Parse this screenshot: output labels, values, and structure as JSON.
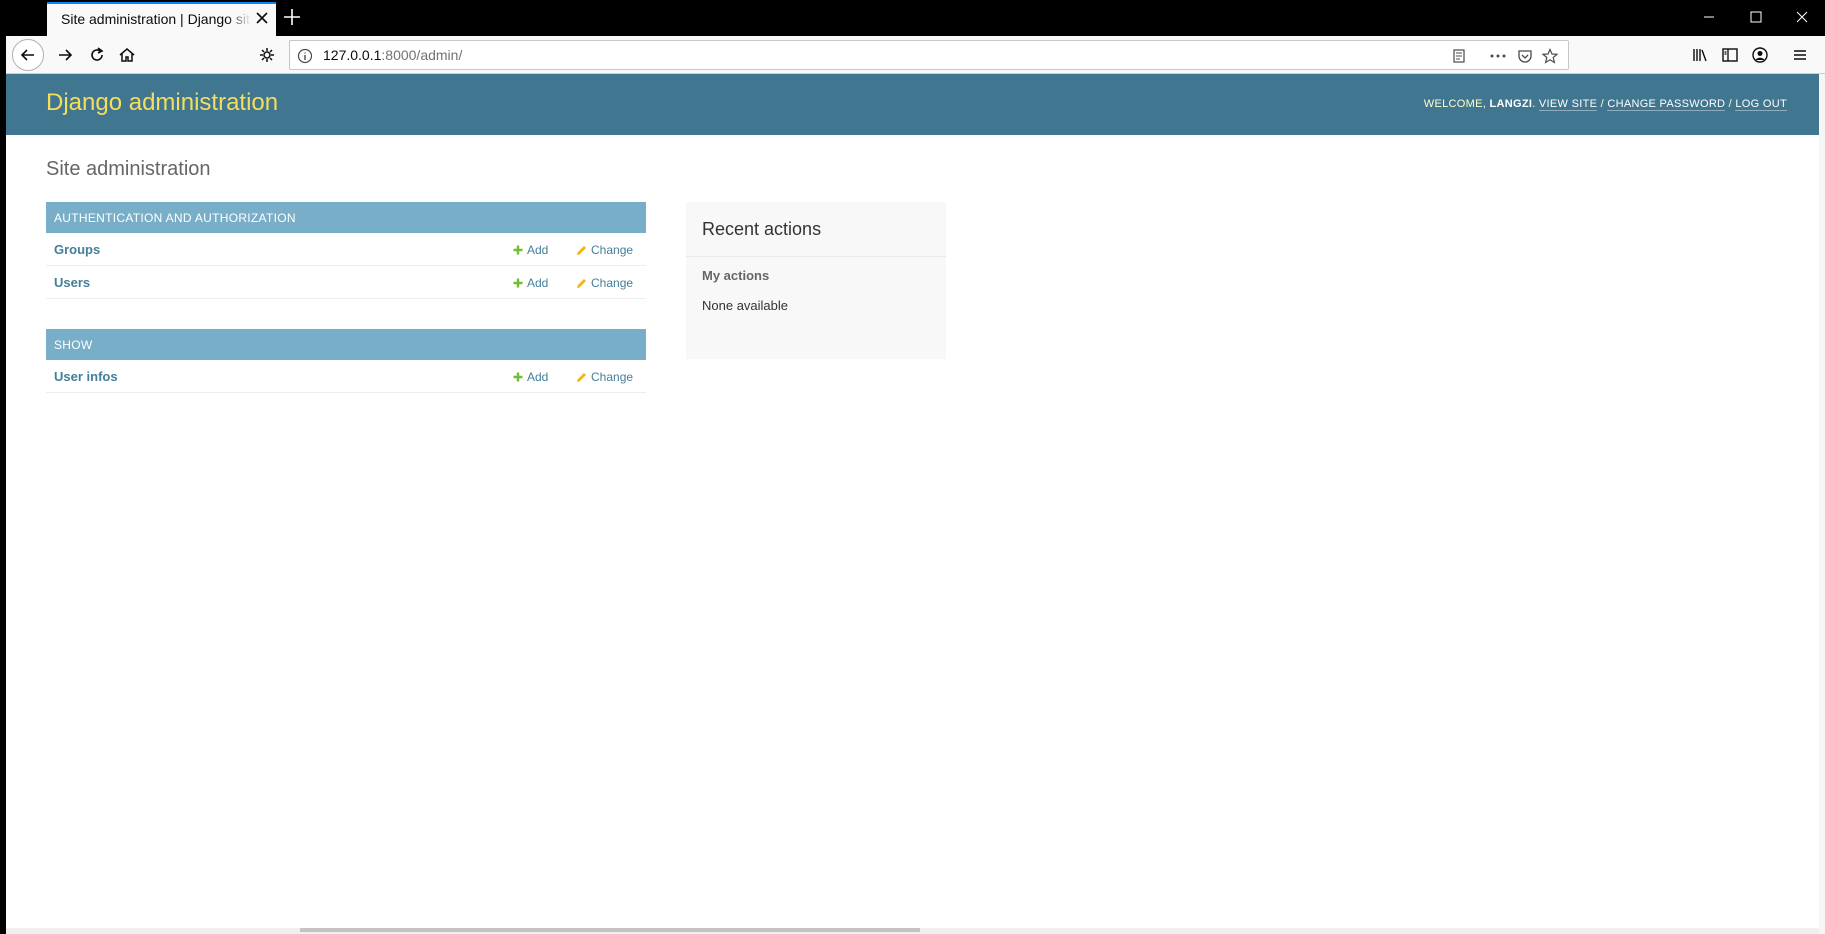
{
  "browser": {
    "tab_title": "Site administration | Django site admin",
    "url_host": "127.0.0.1",
    "url_rest": ":8000/admin/"
  },
  "header": {
    "brand": "Django administration",
    "welcome": "Welcome,",
    "username": "LANGZI",
    "view_site": "View site",
    "change_password": "Change password",
    "log_out": "Log out",
    "sep": "/"
  },
  "content": {
    "title": "Site administration"
  },
  "modules": [
    {
      "caption": "Authentication and Authorization",
      "models": [
        {
          "name": "Groups",
          "add": "Add",
          "change": "Change"
        },
        {
          "name": "Users",
          "add": "Add",
          "change": "Change"
        }
      ]
    },
    {
      "caption": "Show",
      "models": [
        {
          "name": "User infos",
          "add": "Add",
          "change": "Change"
        }
      ]
    }
  ],
  "recent": {
    "title": "Recent actions",
    "subtitle": "My actions",
    "empty": "None available"
  },
  "colors": {
    "header_bg": "#417690",
    "brand": "#f5dd5d",
    "caption_bg": "#79aec8",
    "link": "#447e9b",
    "add_icon": "#70bf2b",
    "change_icon": "#efb80b"
  },
  "icons": [
    "close-icon",
    "plus-icon",
    "minimize-icon",
    "maximize-icon",
    "back-icon",
    "forward-icon",
    "reload-icon",
    "home-icon",
    "gear-icon",
    "info-icon",
    "reader-icon",
    "more-icon",
    "pocket-icon",
    "star-icon",
    "library-icon",
    "sidebar-icon",
    "account-icon",
    "menu-icon",
    "add-icon",
    "pencil-icon"
  ]
}
